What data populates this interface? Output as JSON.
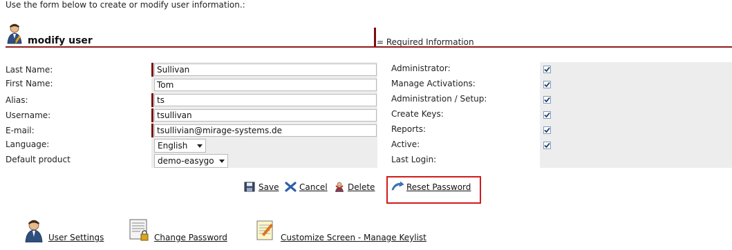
{
  "intro_text": "Use the form below to create or modify user information.:",
  "header": {
    "title": "modify user",
    "required_note": "= Required Information"
  },
  "form": {
    "labels": {
      "last_name": "Last Name:",
      "first_name": "First Name:",
      "alias": "Alias:",
      "username": "Username:",
      "email": "E-mail:",
      "language": "Language:",
      "default_product": "Default product"
    },
    "values": {
      "last_name": "Sullivan",
      "first_name": "Tom",
      "alias": "ts",
      "username": "tsullivan",
      "email": "tsullivian@mirage-systems.de",
      "language": "English",
      "default_product": "demo-easygo"
    }
  },
  "permissions": {
    "labels": {
      "administrator": "Administrator:",
      "manage_activations": "Manage Activations:",
      "admin_setup": "Administration / Setup:",
      "create_keys": "Create Keys:",
      "reports": "Reports:",
      "active": "Active:",
      "last_login": "Last Login:"
    },
    "checked": {
      "administrator": true,
      "manage_activations": true,
      "admin_setup": true,
      "create_keys": true,
      "reports": true,
      "active": true
    },
    "last_login_value": ""
  },
  "actions": {
    "save": "Save",
    "cancel": "Cancel",
    "delete": "Delete",
    "reset_password": "Reset Password"
  },
  "bottom_links": {
    "user_settings": "User Settings",
    "change_password": "Change Password",
    "customize_screen": "Customize Screen - Manage Keylist"
  },
  "colors": {
    "required_marker": "#7a0f0f",
    "header_rule": "#8e1b1b",
    "highlight_box": "#d11a1a",
    "panel_gray": "#ededed"
  }
}
